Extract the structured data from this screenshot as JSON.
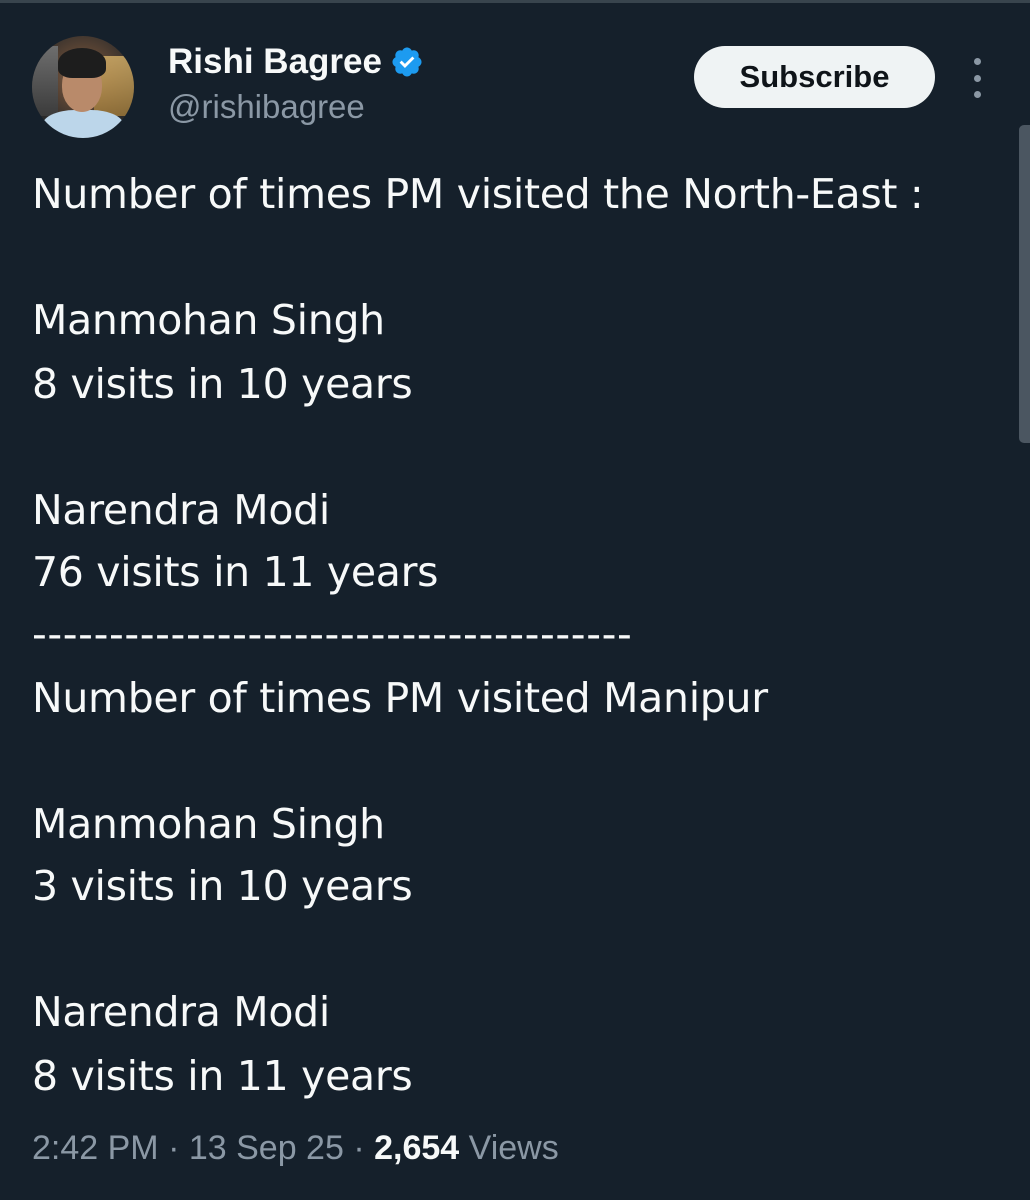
{
  "author": {
    "name": "Rishi Bagree",
    "handle": "@rishibagree",
    "verified": true
  },
  "header": {
    "subscribe_label": "Subscribe",
    "more_icon": "more-vertical-icon"
  },
  "tweet": {
    "lines": [
      "Number of times PM visited the North-East :",
      "Manmohan Singh",
      "8 visits in 10 years",
      "Narendra Modi",
      "76 visits in 11 years",
      "---------------------------------------",
      "Number of times PM visited Manipur",
      "Manmohan Singh",
      "3 visits in 10 years",
      "Narendra Modi",
      "8 visits in 11 years"
    ]
  },
  "meta": {
    "time": "2:42 PM",
    "separator": " · ",
    "date": "13 Sep 25",
    "views_count": "2,654",
    "views_label": " Views"
  },
  "colors": {
    "background": "#15202b",
    "text": "#f7f9f9",
    "secondary": "#8b98a5",
    "verified": "#1d9bf0",
    "button": "#eff3f4"
  }
}
